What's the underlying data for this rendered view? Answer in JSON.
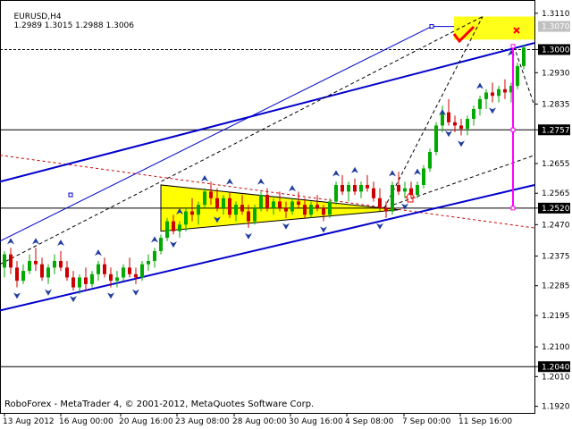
{
  "header": {
    "symbol_timeframe": "EURUSD,H4",
    "ohlc": "1.2989 1.3015 1.2988 1.3006"
  },
  "footer": {
    "copyright": "RoboForex - MetaTrader 4, © 2001-2012, MetaQuotes Software Corp."
  },
  "colors": {
    "bull_candle": "#00aa00",
    "bear_candle": "#cc0000",
    "trend_line": "#0000cc",
    "forecast_marker": "#ff00ff",
    "zone_fill": "#ffff00",
    "resistance_line": "#000000",
    "red_dashed": "#cc0000",
    "check_mark": "#ff0000"
  },
  "icons": [
    "fractal-up-arrow-icon",
    "fractal-down-arrow-icon",
    "check-mark-icon",
    "cross-mark-icon",
    "up-arrow-outline-icon"
  ],
  "chart_data": {
    "type": "candlestick",
    "ylim": [
      1.19,
      1.315
    ],
    "price_axis": {
      "ticks": [
        "1.3110",
        "1.3000",
        "1.2930",
        "1.2835",
        "1.2757",
        "1.2655",
        "1.2565",
        "1.2520",
        "1.2470",
        "1.2375",
        "1.2285",
        "1.2195",
        "1.2100",
        "1.2040",
        "1.2010",
        "1.1920"
      ],
      "tick_values": [
        1.311,
        1.3,
        1.293,
        1.2835,
        1.2757,
        1.2655,
        1.2565,
        1.252,
        1.247,
        1.2375,
        1.2285,
        1.2195,
        1.21,
        1.204,
        1.201,
        1.192
      ],
      "highlighted_levels": [
        {
          "label": "1.3070",
          "value": 1.307,
          "style": "gray"
        },
        {
          "label": "1.3000",
          "value": 1.3,
          "style": "dark"
        },
        {
          "label": "1.2757",
          "value": 1.2757,
          "style": "dark"
        },
        {
          "label": "1.2520",
          "value": 1.252,
          "style": "dark"
        },
        {
          "label": "1.2040",
          "value": 1.204,
          "style": "dark"
        }
      ]
    },
    "time_axis": {
      "labels": [
        "13 Aug 2012",
        "16 Aug 00:00",
        "20 Aug 16:00",
        "23 Aug 08:00",
        "28 Aug 00:00",
        "30 Aug 16:00",
        "4 Sep 08:00",
        "7 Sep 00:00",
        "11 Sep 16:00"
      ]
    },
    "candles": [
      [
        1.234,
        1.239,
        1.231,
        1.238
      ],
      [
        1.238,
        1.24,
        1.232,
        1.234
      ],
      [
        1.234,
        1.236,
        1.228,
        1.23
      ],
      [
        1.23,
        1.235,
        1.229,
        1.233
      ],
      [
        1.233,
        1.238,
        1.232,
        1.236
      ],
      [
        1.236,
        1.24,
        1.233,
        1.235
      ],
      [
        1.235,
        1.237,
        1.23,
        1.231
      ],
      [
        1.231,
        1.235,
        1.229,
        1.234
      ],
      [
        1.234,
        1.238,
        1.232,
        1.236
      ],
      [
        1.236,
        1.239,
        1.233,
        1.234
      ],
      [
        1.234,
        1.236,
        1.23,
        1.231
      ],
      [
        1.231,
        1.233,
        1.227,
        1.228
      ],
      [
        1.228,
        1.232,
        1.226,
        1.231
      ],
      [
        1.231,
        1.234,
        1.227,
        1.229
      ],
      [
        1.229,
        1.233,
        1.228,
        1.232
      ],
      [
        1.232,
        1.236,
        1.23,
        1.235
      ],
      [
        1.235,
        1.237,
        1.231,
        1.232
      ],
      [
        1.232,
        1.234,
        1.228,
        1.23
      ],
      [
        1.23,
        1.233,
        1.228,
        1.231
      ],
      [
        1.231,
        1.235,
        1.23,
        1.234
      ],
      [
        1.234,
        1.237,
        1.231,
        1.232
      ],
      [
        1.232,
        1.234,
        1.229,
        1.231
      ],
      [
        1.231,
        1.236,
        1.23,
        1.235
      ],
      [
        1.235,
        1.238,
        1.233,
        1.236
      ],
      [
        1.236,
        1.24,
        1.234,
        1.239
      ],
      [
        1.239,
        1.244,
        1.238,
        1.243
      ],
      [
        1.243,
        1.249,
        1.242,
        1.248
      ],
      [
        1.248,
        1.25,
        1.244,
        1.245
      ],
      [
        1.245,
        1.248,
        1.243,
        1.247
      ],
      [
        1.247,
        1.252,
        1.245,
        1.251
      ],
      [
        1.251,
        1.255,
        1.248,
        1.25
      ],
      [
        1.25,
        1.254,
        1.247,
        1.253
      ],
      [
        1.253,
        1.258,
        1.252,
        1.257
      ],
      [
        1.257,
        1.26,
        1.253,
        1.255
      ],
      [
        1.255,
        1.258,
        1.251,
        1.252
      ],
      [
        1.252,
        1.256,
        1.25,
        1.255
      ],
      [
        1.255,
        1.257,
        1.249,
        1.25
      ],
      [
        1.25,
        1.254,
        1.248,
        1.253
      ],
      [
        1.253,
        1.256,
        1.25,
        1.251
      ],
      [
        1.251,
        1.253,
        1.246,
        1.248
      ],
      [
        1.248,
        1.253,
        1.247,
        1.252
      ],
      [
        1.252,
        1.257,
        1.251,
        1.256
      ],
      [
        1.256,
        1.258,
        1.251,
        1.252
      ],
      [
        1.252,
        1.255,
        1.25,
        1.254
      ],
      [
        1.254,
        1.257,
        1.251,
        1.252
      ],
      [
        1.252,
        1.254,
        1.249,
        1.251
      ],
      [
        1.251,
        1.255,
        1.25,
        1.254
      ],
      [
        1.254,
        1.257,
        1.252,
        1.253
      ],
      [
        1.253,
        1.255,
        1.249,
        1.25
      ],
      [
        1.25,
        1.254,
        1.249,
        1.253
      ],
      [
        1.253,
        1.256,
        1.251,
        1.252
      ],
      [
        1.252,
        1.253,
        1.248,
        1.25
      ],
      [
        1.25,
        1.255,
        1.249,
        1.254
      ],
      [
        1.254,
        1.26,
        1.253,
        1.259
      ],
      [
        1.259,
        1.262,
        1.256,
        1.257
      ],
      [
        1.257,
        1.26,
        1.254,
        1.259
      ],
      [
        1.259,
        1.261,
        1.256,
        1.257
      ],
      [
        1.257,
        1.26,
        1.255,
        1.259
      ],
      [
        1.259,
        1.262,
        1.257,
        1.258
      ],
      [
        1.258,
        1.26,
        1.254,
        1.255
      ],
      [
        1.255,
        1.258,
        1.251,
        1.252
      ],
      [
        1.252,
        1.254,
        1.249,
        1.251
      ],
      [
        1.251,
        1.26,
        1.25,
        1.259
      ],
      [
        1.259,
        1.263,
        1.256,
        1.257
      ],
      [
        1.257,
        1.26,
        1.255,
        1.258
      ],
      [
        1.258,
        1.26,
        1.255,
        1.256
      ],
      [
        1.256,
        1.26,
        1.255,
        1.259
      ],
      [
        1.259,
        1.265,
        1.258,
        1.264
      ],
      [
        1.264,
        1.27,
        1.263,
        1.269
      ],
      [
        1.269,
        1.278,
        1.268,
        1.277
      ],
      [
        1.277,
        1.283,
        1.275,
        1.281
      ],
      [
        1.281,
        1.285,
        1.277,
        1.278
      ],
      [
        1.278,
        1.28,
        1.275,
        1.277
      ],
      [
        1.277,
        1.279,
        1.274,
        1.276
      ],
      [
        1.276,
        1.28,
        1.274,
        1.279
      ],
      [
        1.279,
        1.283,
        1.277,
        1.282
      ],
      [
        1.282,
        1.286,
        1.28,
        1.285
      ],
      [
        1.285,
        1.288,
        1.282,
        1.287
      ],
      [
        1.287,
        1.29,
        1.284,
        1.286
      ],
      [
        1.286,
        1.289,
        1.284,
        1.288
      ],
      [
        1.288,
        1.291,
        1.285,
        1.287
      ],
      [
        1.287,
        1.29,
        1.284,
        1.289
      ],
      [
        1.289,
        1.296,
        1.288,
        1.295
      ],
      [
        1.295,
        1.3015,
        1.294,
        1.3006
      ]
    ],
    "fractals_up": [
      [
        1,
        1.24
      ],
      [
        5,
        1.24
      ],
      [
        9,
        1.2395
      ],
      [
        15,
        1.2365
      ],
      [
        24,
        1.2405
      ],
      [
        28,
        1.249
      ],
      [
        32,
        1.259
      ],
      [
        36,
        1.258
      ],
      [
        41,
        1.258
      ],
      [
        46,
        1.256
      ],
      [
        53,
        1.2605
      ],
      [
        56,
        1.2615
      ],
      [
        62,
        1.2605
      ],
      [
        66,
        1.261
      ],
      [
        70,
        1.279
      ],
      [
        76,
        1.287
      ],
      [
        81,
        1.297
      ]
    ],
    "fractals_down": [
      [
        2,
        1.2275
      ],
      [
        7,
        1.2285
      ],
      [
        11,
        1.2265
      ],
      [
        17,
        1.2275
      ],
      [
        21,
        1.2285
      ],
      [
        27,
        1.243
      ],
      [
        34,
        1.2505
      ],
      [
        39,
        1.2455
      ],
      [
        45,
        1.2485
      ],
      [
        51,
        1.2475
      ],
      [
        60,
        1.2485
      ],
      [
        64,
        1.2545
      ],
      [
        71,
        1.2765
      ],
      [
        73,
        1.2735
      ],
      [
        78,
        1.2835
      ]
    ],
    "annotations": {
      "triangle_zone": "yellow",
      "target_zone": "yellow",
      "forecast_segment": "magenta"
    }
  }
}
